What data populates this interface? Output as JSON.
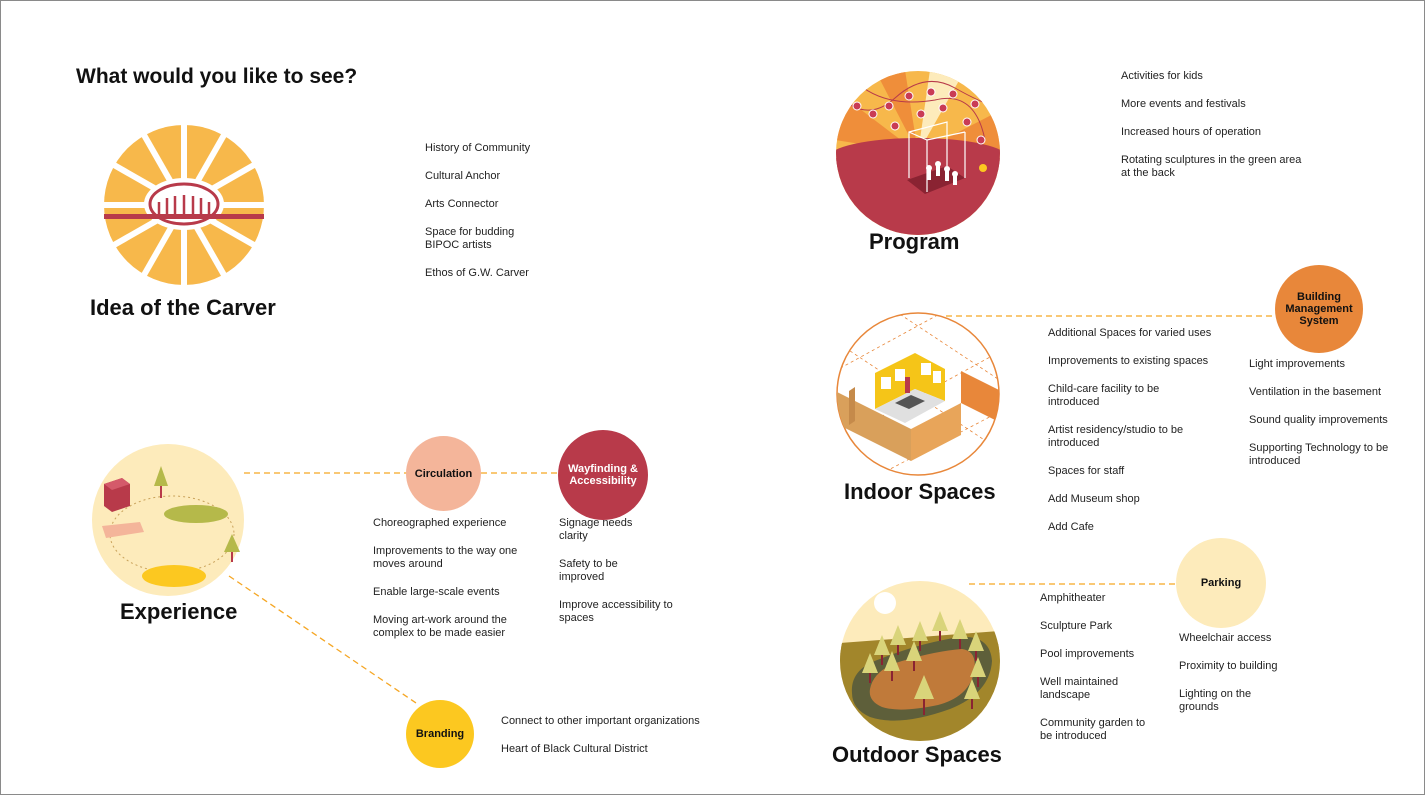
{
  "page": {
    "heading": "What would you like to see?"
  },
  "colors": {
    "yellow": "#f7b84b",
    "deep_red": "#b83a4a",
    "orange": "#e8873a",
    "peach": "#f4b59a",
    "pale_yellow": "#fdebbb",
    "gold": "#fcc820",
    "dashed_line": "#f5a623"
  },
  "sections": {
    "idea": {
      "title": "Idea of the Carver",
      "icon": "sunburst-building-icon",
      "items": [
        "History of Community",
        "Cultural Anchor",
        "Arts Connector",
        "Space for budding BIPOC artists",
        "Ethos of G.W. Carver"
      ]
    },
    "program": {
      "title": "Program",
      "icon": "stage-with-lights-icon",
      "items": [
        "Activities for kids",
        "More events and festivals",
        "Increased hours of operation",
        "Rotating sculptures in the green area at the back"
      ]
    },
    "indoor": {
      "title": "Indoor Spaces",
      "icon": "isometric-room-icon",
      "items": [
        "Additional Spaces for varied uses",
        "Improvements to existing spaces",
        "Child-care facility to be introduced",
        "Artist residency/studio to be introduced",
        "Spaces for staff",
        "Add Museum shop",
        "Add Cafe"
      ]
    },
    "building_management": {
      "title": "Building Management System",
      "items": [
        "Light improvements",
        "Ventilation in the basement",
        "Sound quality improvements",
        "Supporting Technology to be introduced"
      ]
    },
    "experience": {
      "title": "Experience",
      "icon": "site-plan-icon"
    },
    "circulation": {
      "title": "Circulation",
      "items": [
        "Choreographed experience",
        "Improvements to the way one moves around",
        "Enable large-scale events",
        "Moving art-work around the complex to be made easier"
      ]
    },
    "wayfinding": {
      "title": "Wayfinding & Accessibility",
      "items": [
        "Signage needs clarity",
        "Safety to be improved",
        "Improve accessibility to spaces"
      ]
    },
    "branding": {
      "title": "Branding",
      "items": [
        "Connect to other important organizations",
        "Heart of Black Cultural District"
      ]
    },
    "outdoor": {
      "title": "Outdoor Spaces",
      "icon": "park-with-trees-icon",
      "items": [
        "Amphitheater",
        "Sculpture Park",
        "Pool improvements",
        "Well maintained landscape",
        "Community garden to be introduced"
      ]
    },
    "parking": {
      "title": "Parking",
      "items": [
        "Wheelchair access",
        "Proximity to building",
        "Lighting on the grounds"
      ]
    }
  }
}
